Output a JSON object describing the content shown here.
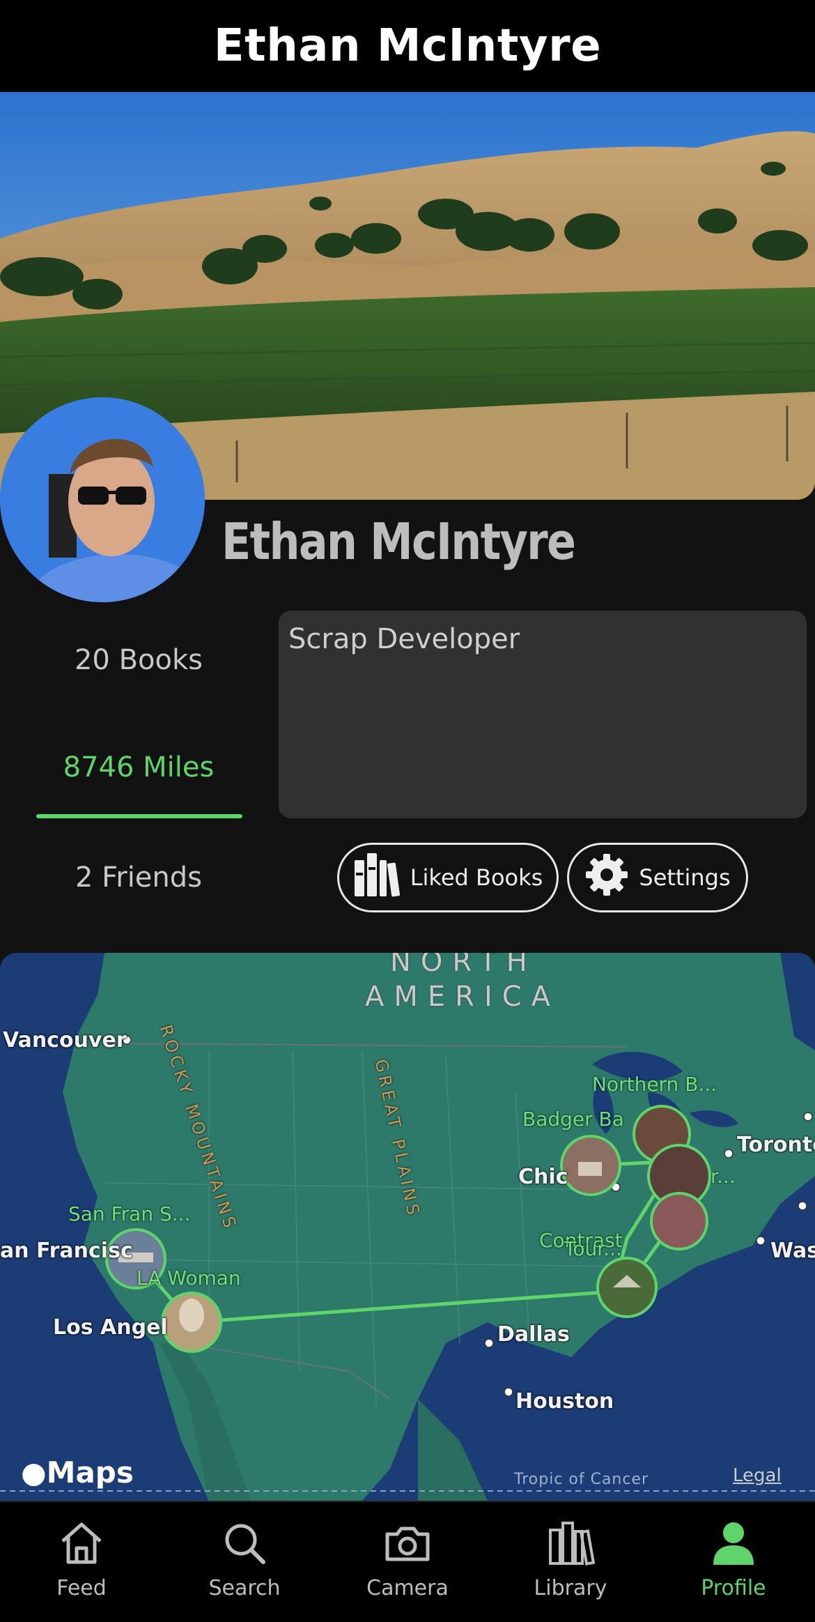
{
  "header": {
    "title": "Ethan McIntyre"
  },
  "profile": {
    "name": "Ethan McIntyre",
    "bio": "Scrap Developer",
    "stats": {
      "books": "20 Books",
      "miles": "8746 Miles",
      "friends": "2 Friends"
    },
    "buttons": {
      "liked_books": "Liked Books",
      "settings": "Settings"
    }
  },
  "map": {
    "region_line1": "NORTH",
    "region_line2": "AMERICA",
    "mountains": "ROCKY MOUNTAINS",
    "plains": "GREAT PLAINS",
    "cities": {
      "vancouver": "Vancouver",
      "san_francisco": "an Francisc",
      "los_angeles": "Los Angel",
      "chicago": "Chic",
      "toronto": "Toronto",
      "dallas": "Dallas",
      "houston": "Houston",
      "washington": "Was"
    },
    "pins": {
      "northern": "Northern B...",
      "badger": "Badger Ba",
      "san_fran": "San Fran S...",
      "la_woman": "LA Woman",
      "contrast": "Contrast",
      "tour": "Tour...",
      "east_r": "r..."
    },
    "tropic": "Tropic of Cancer",
    "maps_logo": "Maps",
    "legal": "Legal",
    "route_color": "#5fd46a"
  },
  "tabs": [
    {
      "label": "Feed",
      "icon": "home-icon"
    },
    {
      "label": "Search",
      "icon": "search-icon"
    },
    {
      "label": "Camera",
      "icon": "camera-icon"
    },
    {
      "label": "Library",
      "icon": "library-icon"
    },
    {
      "label": "Profile",
      "icon": "person-icon",
      "active": true
    }
  ],
  "colors": {
    "accent": "#5fd46a",
    "background": "#121212"
  }
}
